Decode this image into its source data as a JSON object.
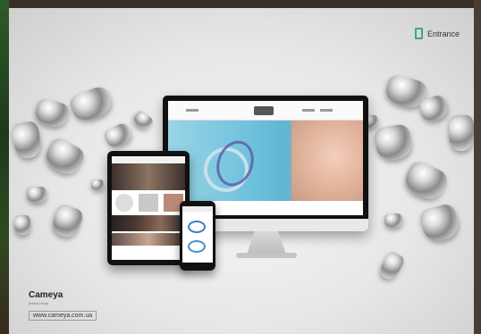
{
  "poster": {
    "entrance_label": "Entrance",
    "entrance_icon": "door-icon",
    "brand": {
      "name": "Cameya",
      "tagline": "jewelry shop",
      "url": "www.cameya.com.ua"
    },
    "colors": {
      "accent": "#3fa58f",
      "background": "#e7e7e7",
      "hero_blue": "#6cc0dc"
    }
  }
}
